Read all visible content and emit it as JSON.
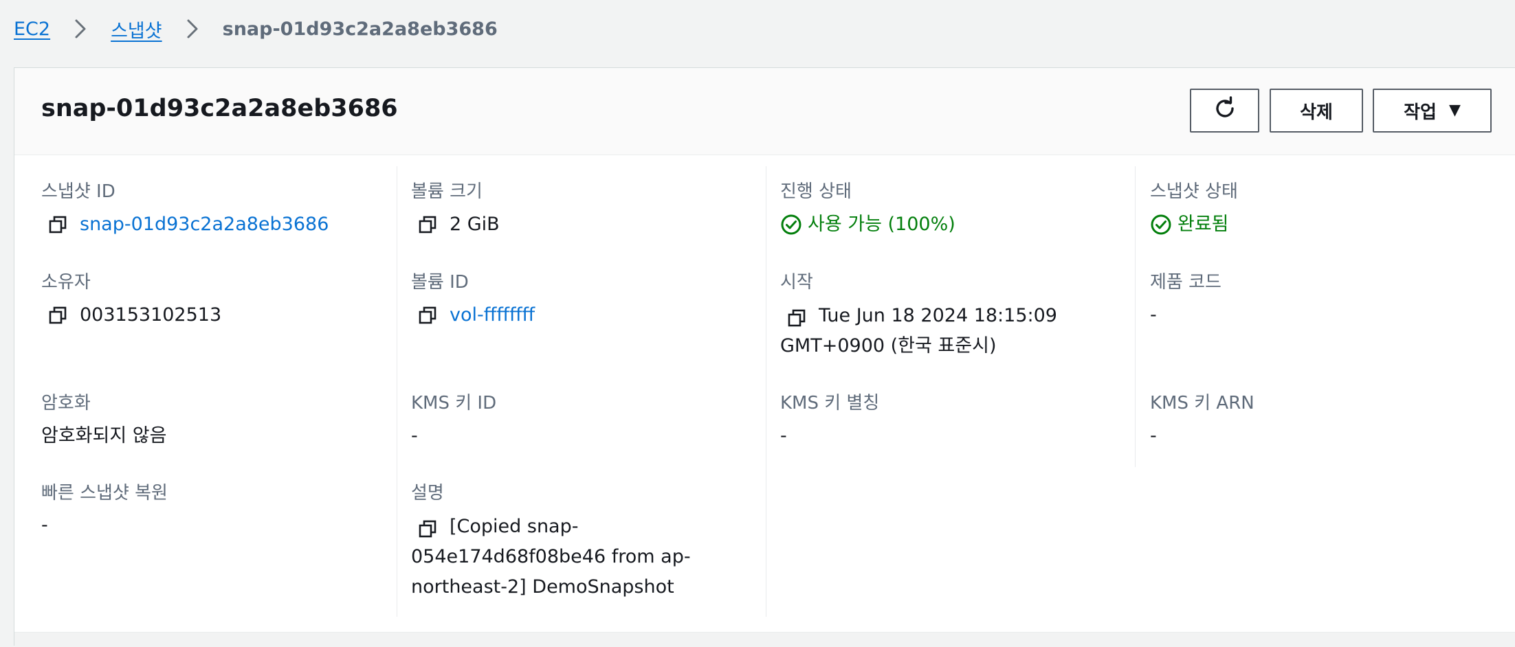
{
  "breadcrumb": {
    "items": [
      "EC2",
      "스냅샷"
    ],
    "current": "snap-01d93c2a2a8eb3686"
  },
  "header": {
    "title": "snap-01d93c2a2a8eb3686",
    "refresh_icon": "refresh-icon",
    "delete_label": "삭제",
    "actions_label": "작업",
    "actions_caret": "▼"
  },
  "details": {
    "snapshot_id": {
      "label": "스냅샷 ID",
      "value": "snap-01d93c2a2a8eb3686"
    },
    "owner": {
      "label": "소유자",
      "value": "003153102513"
    },
    "encryption": {
      "label": "암호화",
      "value": "암호화되지 않음"
    },
    "fast_restore": {
      "label": "빠른 스냅샷 복원",
      "value": "-"
    },
    "volume_size": {
      "label": "볼륨 크기",
      "value": "2 GiB"
    },
    "volume_id": {
      "label": "볼륨 ID",
      "value": "vol-ffffffff"
    },
    "kms_key_id": {
      "label": "KMS 키 ID",
      "value": "-"
    },
    "description": {
      "label": "설명",
      "value": "[Copied snap-054e174d68f08be46 from ap-northeast-2] DemoSnapshot"
    },
    "progress": {
      "label": "진행 상태",
      "value": "사용 가능 (100%)"
    },
    "started": {
      "label": "시작",
      "value": "Tue Jun 18 2024 18:15:09 GMT+0900 (한국 표준시)"
    },
    "kms_key_alias": {
      "label": "KMS 키 별칭",
      "value": "-"
    },
    "snapshot_state": {
      "label": "스냅샷 상태",
      "value": "완료됨"
    },
    "product_code": {
      "label": "제품 코드",
      "value": "-"
    },
    "kms_key_arn": {
      "label": "KMS 키 ARN",
      "value": "-"
    }
  },
  "colors": {
    "link": "#0972d3",
    "success": "#037f0c",
    "label": "#5f6b7a",
    "text": "#16191f"
  }
}
